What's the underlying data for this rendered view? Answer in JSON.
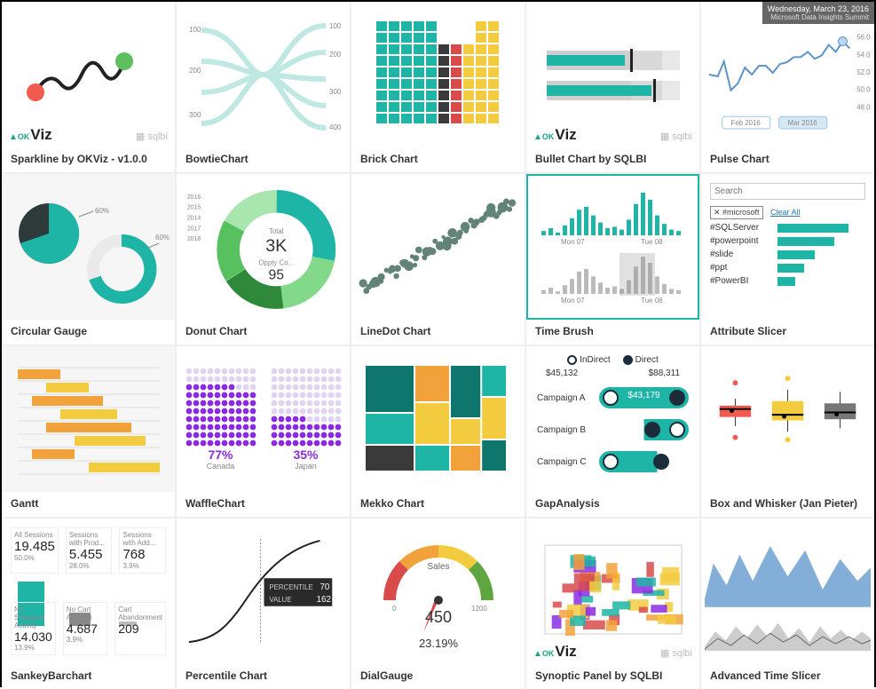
{
  "cards": [
    {
      "id": "sparkline",
      "title": "Sparkline by OKViz - v1.0.0",
      "okviz": true,
      "sqlbi": true
    },
    {
      "id": "bowtie",
      "title": "BowtieChart"
    },
    {
      "id": "brick",
      "title": "Brick Chart"
    },
    {
      "id": "bullet",
      "title": "Bullet Chart by SQLBI",
      "okviz": true,
      "sqlbi": true
    },
    {
      "id": "pulse",
      "title": "Pulse Chart"
    },
    {
      "id": "circgauge",
      "title": "Circular Gauge"
    },
    {
      "id": "donut",
      "title": "Donut Chart"
    },
    {
      "id": "linedot",
      "title": "LineDot Chart"
    },
    {
      "id": "timebrush",
      "title": "Time Brush"
    },
    {
      "id": "attrslicer",
      "title": "Attribute Slicer"
    },
    {
      "id": "gantt",
      "title": "Gantt"
    },
    {
      "id": "waffle",
      "title": "WaffleChart"
    },
    {
      "id": "mekko",
      "title": "Mekko Chart"
    },
    {
      "id": "gap",
      "title": "GapAnalysis"
    },
    {
      "id": "box",
      "title": "Box and Whisker (Jan Pieter)"
    },
    {
      "id": "sankeybar",
      "title": "SankeyBarchart"
    },
    {
      "id": "percentile",
      "title": "Percentile Chart"
    },
    {
      "id": "dialgauge",
      "title": "DialGauge"
    },
    {
      "id": "synoptic",
      "title": "Synoptic Panel by SQLBI",
      "okviz": true,
      "sqlbi": true
    },
    {
      "id": "advtime",
      "title": "Advanced Time Slicer"
    }
  ],
  "chart_data": [
    {
      "id": "sparkline",
      "type": "line",
      "title": "Sparkline",
      "x": [
        1,
        2,
        3,
        4,
        5,
        6,
        7
      ],
      "values": [
        40,
        55,
        35,
        60,
        45,
        70,
        62
      ],
      "endpoints": {
        "start_color": "#f05a4f",
        "end_color": "#5fbf5f"
      }
    },
    {
      "id": "bowtie",
      "type": "bowtie",
      "left_ticks": [
        100,
        200,
        300
      ],
      "right_ticks": [
        100,
        200,
        300,
        400
      ],
      "flows": 8
    },
    {
      "id": "brick",
      "type": "heatmap",
      "rows": 9,
      "cols": 10,
      "colors": [
        "#1fb5a6",
        "#1fb5a6",
        "#1fb5a6",
        "#1fb5a6",
        "#1fb5a6",
        "#3a3a3a",
        "#d94b4b",
        "#f3cb3f",
        "#f3cb3f",
        "#f3cb3f"
      ]
    },
    {
      "id": "bullet",
      "type": "bullet",
      "bars": [
        {
          "qual": [
            60,
            85,
            100
          ],
          "measure": 58,
          "target": 62
        },
        {
          "qual": [
            60,
            85,
            100
          ],
          "measure": 78,
          "target": 80
        }
      ],
      "colors": {
        "measure": "#1fb5a6",
        "range": "#d9d9d9"
      }
    },
    {
      "id": "pulse",
      "type": "line",
      "tooltip": {
        "date": "Wednesday, March 23, 2016",
        "subtitle": "Microsoft Data Insights Summit"
      },
      "yticks": [
        48.0,
        50.0,
        52.0,
        54.0,
        56.0
      ],
      "xticks": [
        "Feb 2016",
        "Mar 2016"
      ],
      "values": [
        51,
        50.5,
        53,
        49.5,
        50,
        52,
        51,
        52,
        52,
        51,
        52,
        52.5,
        53,
        53,
        54,
        53,
        53.5,
        55,
        54,
        55.5
      ]
    },
    {
      "id": "circgauge",
      "type": "gauge",
      "pies": [
        {
          "percent": 60,
          "colors": [
            "#1fb5a6",
            "#2e3a3a"
          ]
        },
        {
          "percent": 60,
          "colors": [
            "#1fb5a6",
            "#eaeaea"
          ],
          "ring": true
        }
      ]
    },
    {
      "id": "donut",
      "type": "pie",
      "center": {
        "top_label": "Total",
        "top_value": "3K",
        "bottom_label": "Oppty Co...",
        "bottom_value": "95"
      },
      "legend_years": [
        2016,
        2015,
        2014,
        2017,
        2018
      ],
      "slices": [
        {
          "value": 28,
          "color": "#1fb5a6"
        },
        {
          "value": 20,
          "color": "#82d98a"
        },
        {
          "value": 18,
          "color": "#2e8a3a"
        },
        {
          "value": 17,
          "color": "#56c15e"
        },
        {
          "value": 17,
          "color": "#a9e6af"
        }
      ]
    },
    {
      "id": "linedot",
      "type": "scatter",
      "points": 50,
      "trend": "up-right",
      "color": "#2e5a4b"
    },
    {
      "id": "timebrush",
      "type": "bar",
      "xticks_top": [
        "Mon 07",
        "Tue 08"
      ],
      "xticks_bot": [
        "Mon 07",
        "Tue 08"
      ],
      "top_values": [
        3,
        5,
        2,
        7,
        12,
        18,
        20,
        14,
        9,
        5,
        6,
        4,
        11,
        22,
        30,
        25,
        14,
        8,
        4,
        3
      ],
      "selection": {
        "start": 0.55,
        "end": 0.75
      },
      "color": "#1fb5a6"
    },
    {
      "id": "attrslicer",
      "type": "table",
      "search_placeholder": "Search",
      "chip": "#microsoft",
      "clear": "Clear All",
      "rows": [
        {
          "label": "#SQLServer",
          "value": 100
        },
        {
          "label": "#powerpoint",
          "value": 80
        },
        {
          "label": "#slide",
          "value": 52
        },
        {
          "label": "#ppt",
          "value": 38
        },
        {
          "label": "#PowerBI",
          "value": 26
        }
      ]
    },
    {
      "id": "gantt",
      "type": "gantt",
      "rows": 8,
      "range": [
        0,
        10
      ],
      "bars": [
        {
          "row": 0,
          "start": 0,
          "end": 3,
          "color": "#f2a23a"
        },
        {
          "row": 1,
          "start": 2,
          "end": 5,
          "color": "#f3cb3f"
        },
        {
          "row": 2,
          "start": 1,
          "end": 6,
          "color": "#f2a23a"
        },
        {
          "row": 3,
          "start": 3,
          "end": 7,
          "color": "#f3cb3f"
        },
        {
          "row": 4,
          "start": 2,
          "end": 8,
          "color": "#f2a23a"
        },
        {
          "row": 5,
          "start": 4,
          "end": 9,
          "color": "#f3cb3f"
        },
        {
          "row": 6,
          "start": 1,
          "end": 4,
          "color": "#f2a23a"
        },
        {
          "row": 7,
          "start": 5,
          "end": 10,
          "color": "#f3cb3f"
        }
      ]
    },
    {
      "id": "waffle",
      "type": "waffle",
      "items": [
        {
          "label": "Canada",
          "percent": 77,
          "color": "#8a2be2"
        },
        {
          "label": "Japan",
          "percent": 35,
          "color": "#8a2be2"
        }
      ],
      "grid": "10x10"
    },
    {
      "id": "mekko",
      "type": "mekko",
      "columns": [
        {
          "width": 0.35,
          "segments": [
            {
              "h": 0.45,
              "color": "#0f766e"
            },
            {
              "h": 0.3,
              "color": "#1fb5a6"
            },
            {
              "h": 0.25,
              "color": "#3a3a3a"
            }
          ]
        },
        {
          "width": 0.25,
          "segments": [
            {
              "h": 0.35,
              "color": "#f2a23a"
            },
            {
              "h": 0.4,
              "color": "#f3cb3f"
            },
            {
              "h": 0.25,
              "color": "#1fb5a6"
            }
          ]
        },
        {
          "width": 0.22,
          "segments": [
            {
              "h": 0.5,
              "color": "#0f766e"
            },
            {
              "h": 0.25,
              "color": "#f3cb3f"
            },
            {
              "h": 0.25,
              "color": "#f2a23a"
            }
          ]
        },
        {
          "width": 0.18,
          "segments": [
            {
              "h": 0.3,
              "color": "#1fb5a6"
            },
            {
              "h": 0.4,
              "color": "#f3cb3f"
            },
            {
              "h": 0.3,
              "color": "#0f766e"
            }
          ]
        }
      ]
    },
    {
      "id": "gap",
      "type": "gap",
      "legend": [
        {
          "label": "InDirect",
          "fill": "none",
          "stroke": "#1b2d3a"
        },
        {
          "label": "Direct",
          "fill": "#1b2d3a"
        }
      ],
      "left_total": "$45,132",
      "right_total": "$88,311",
      "rows": [
        {
          "label": "Campaign A",
          "value": "$43,179",
          "left": 0.1,
          "right": 0.9
        },
        {
          "label": "Campaign B",
          "value": "",
          "left": 0.55,
          "right": 0.92
        },
        {
          "label": "Campaign C",
          "value": "",
          "left": 0.05,
          "right": 0.7
        }
      ],
      "pill_color": "#1fb5a6"
    },
    {
      "id": "box",
      "type": "boxplot",
      "series": [
        {
          "color": "#f05a4f",
          "min": 40,
          "q1": 48,
          "med": 55,
          "q3": 58,
          "max": 64,
          "outliers": [
            30,
            78
          ]
        },
        {
          "color": "#f3cb3f",
          "min": 35,
          "q1": 45,
          "med": 50,
          "q3": 62,
          "max": 72,
          "outliers": [
            28,
            82
          ]
        },
        {
          "color": "#777777",
          "min": 38,
          "q1": 46,
          "med": 52,
          "q3": 60,
          "max": 70,
          "outliers": []
        }
      ]
    },
    {
      "id": "sankeybar",
      "type": "kpi",
      "top": [
        {
          "label": "All Sessions",
          "value": "19.485",
          "pct": "50.0%"
        },
        {
          "label": "Sessions with Prod...",
          "value": "5.455",
          "pct": "28.0%"
        },
        {
          "label": "Sessions with Add...",
          "value": "768",
          "pct": "3.9%"
        }
      ],
      "bars": [
        {
          "h": 0.85,
          "color": "#1fb5a6"
        },
        {
          "h": 0.18,
          "color": "#888"
        },
        {
          "h": 0.06,
          "color": "#bbb"
        }
      ],
      "bottom": [
        {
          "label": "No Shopping Activity",
          "value": "14.030",
          "pct": "13.9%"
        },
        {
          "label": "No Cart Addition",
          "value": "4.687",
          "pct": "3.9%"
        },
        {
          "label": "Cart Abandonment",
          "value": "209",
          "pct": ""
        }
      ]
    },
    {
      "id": "percentile",
      "type": "line",
      "tooltip": {
        "percentile_label": "PERCENTILE",
        "percentile": 70,
        "value_label": "VALUE",
        "value": 162
      },
      "curve": "s-curve"
    },
    {
      "id": "dialgauge",
      "type": "gauge",
      "label": "Sales",
      "min": 0,
      "max": 1200,
      "value": 450,
      "percent": "23.19%",
      "zones": [
        {
          "color": "#d94b4b"
        },
        {
          "color": "#f2a23a"
        },
        {
          "color": "#f3cb3f"
        },
        {
          "color": "#5fa641"
        }
      ]
    },
    {
      "id": "synoptic",
      "type": "map",
      "tiles": 40,
      "palette": [
        "#1fb5a6",
        "#f3cb3f",
        "#f2a23a",
        "#d94b4b",
        "#8a2be2"
      ]
    },
    {
      "id": "advtime",
      "type": "area",
      "series": 2,
      "overview": true,
      "color": "#5a93c9"
    }
  ],
  "pulse_tip": {
    "line1": "Wednesday, March 23, 2016",
    "line2": "Microsoft Data Insights Summit"
  },
  "donut_center": {
    "l1": "Total",
    "v1": "3K",
    "l2": "Oppty Co...",
    "v2": "95"
  },
  "slicer": {
    "placeholder": "Search",
    "chip": "#microsoft",
    "clear": "Clear All",
    "rows": [
      [
        "#SQLServer",
        100
      ],
      [
        "#powerpoint",
        80
      ],
      [
        "#slide",
        52
      ],
      [
        "#ppt",
        38
      ],
      [
        "#PowerBI",
        26
      ]
    ]
  },
  "gap": {
    "legend": [
      "InDirect",
      "Direct"
    ],
    "left": "$45,132",
    "right": "$88,311",
    "rows": [
      [
        "Campaign A",
        "$43,179"
      ],
      [
        "Campaign B",
        ""
      ],
      [
        "Campaign C",
        ""
      ]
    ]
  },
  "waffle": [
    [
      "77%",
      "Canada"
    ],
    [
      "35%",
      "Japan"
    ]
  ],
  "percentile_tip": {
    "l1": "PERCENTILE",
    "v1": "70",
    "l2": "VALUE",
    "v2": "162"
  },
  "dial": {
    "label": "Sales",
    "min": "0",
    "max": "1200",
    "value": "450",
    "pct": "23.19%"
  },
  "sankey": {
    "top": [
      [
        "All Sessions",
        "19.485",
        "50.0%"
      ],
      [
        "Sessions with Prod...",
        "5.455",
        "28.0%"
      ],
      [
        "Sessions with Add...",
        "768",
        "3.9%"
      ]
    ],
    "bot": [
      [
        "No Shopping Activity",
        "14.030",
        "13.9%"
      ],
      [
        "No Cart Addition",
        "4.687",
        "3.9%"
      ],
      [
        "Cart Abandonment",
        "209",
        ""
      ]
    ]
  },
  "timebrush": {
    "ticks": [
      "Mon 07",
      "Tue 08"
    ]
  },
  "circ": {
    "p1": "60%",
    "p2": "60%"
  },
  "bowtie_ticks": {
    "left": [
      "100",
      "200",
      "300"
    ],
    "right": [
      "100",
      "200",
      "300",
      "400"
    ]
  },
  "pulse_y": [
    "56.00",
    "54.00",
    "52.00",
    "50.00",
    "48.00"
  ],
  "pulse_x": [
    "Feb 2016",
    "Mar 2016"
  ]
}
